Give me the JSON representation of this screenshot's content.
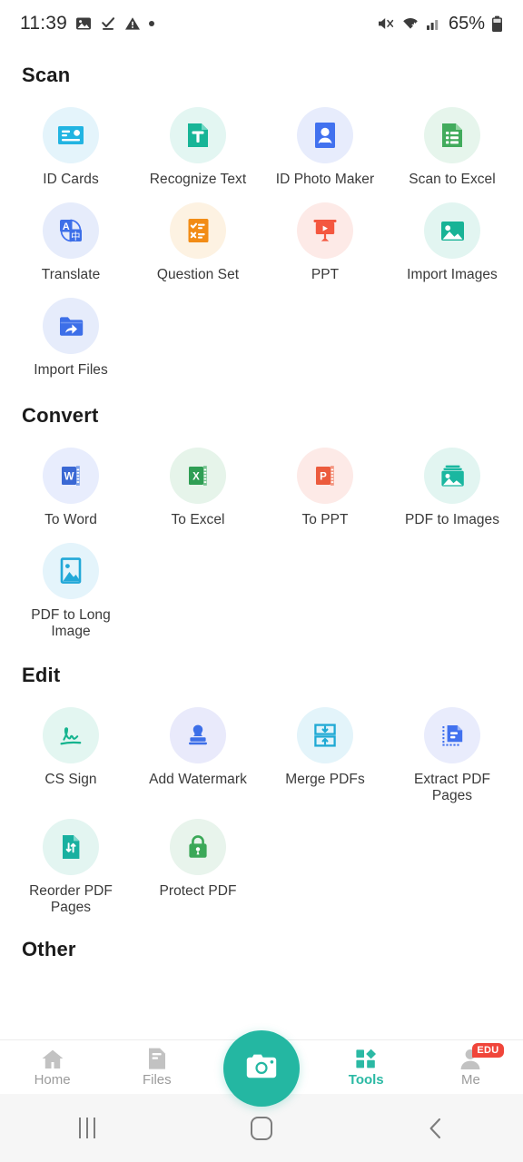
{
  "status_bar": {
    "time": "11:39",
    "left_icons": [
      "image-icon",
      "download-complete-icon",
      "warning-icon",
      "dot-icon"
    ],
    "right_icons": [
      "mute-icon",
      "wifi-icon",
      "signal-icon"
    ],
    "battery_percent": "65%"
  },
  "sections": [
    {
      "id": "scan",
      "title": "Scan",
      "items": [
        {
          "label": "ID Cards",
          "icon": "id-card-icon",
          "bubble": "#e4f4fb",
          "color": "#21b4e2"
        },
        {
          "label": "Recognize Text",
          "icon": "recognize-text-icon",
          "bubble": "#e3f6f2",
          "color": "#17b597"
        },
        {
          "label": "ID Photo Maker",
          "icon": "id-photo-icon",
          "bubble": "#e7ecfc",
          "color": "#4171ef"
        },
        {
          "label": "Scan to Excel",
          "icon": "scan-excel-icon",
          "bubble": "#e6f5ec",
          "color": "#41ab5c"
        },
        {
          "label": "Translate",
          "icon": "translate-icon",
          "bubble": "#e6ecfb",
          "color": "#3d6fe8"
        },
        {
          "label": "Question Set",
          "icon": "question-set-icon",
          "bubble": "#fdf2e2",
          "color": "#f28c16"
        },
        {
          "label": "PPT",
          "icon": "ppt-icon",
          "bubble": "#fdeae7",
          "color": "#f4573f"
        },
        {
          "label": "Import Images",
          "icon": "import-images-icon",
          "bubble": "#e2f5f1",
          "color": "#18b396"
        },
        {
          "label": "Import Files",
          "icon": "import-files-icon",
          "bubble": "#e6ecfb",
          "color": "#3d6fe8"
        }
      ]
    },
    {
      "id": "convert",
      "title": "Convert",
      "items": [
        {
          "label": "To Word",
          "icon": "word-icon",
          "bubble": "#e8edfd",
          "color": "#3a68d4"
        },
        {
          "label": "To Excel",
          "icon": "excel-icon",
          "bubble": "#e6f4ea",
          "color": "#2f9e54"
        },
        {
          "label": "To PPT",
          "icon": "powerpoint-icon",
          "bubble": "#fdeae7",
          "color": "#ec5b3d"
        },
        {
          "label": "PDF to Images",
          "icon": "pdf-images-icon",
          "bubble": "#e2f5f1",
          "color": "#1ab7a0"
        },
        {
          "label": "PDF to Long Image",
          "icon": "long-image-icon",
          "bubble": "#e4f4fb",
          "color": "#22a8d8"
        }
      ]
    },
    {
      "id": "edit",
      "title": "Edit",
      "items": [
        {
          "label": "CS Sign",
          "icon": "signature-icon",
          "bubble": "#e3f6f1",
          "color": "#16b48f"
        },
        {
          "label": "Add Watermark",
          "icon": "stamp-icon",
          "bubble": "#e9eafb",
          "color": "#3d6fe8"
        },
        {
          "label": "Merge PDFs",
          "icon": "merge-pdf-icon",
          "bubble": "#e3f4fa",
          "color": "#1fa9d4"
        },
        {
          "label": "Extract PDF Pages",
          "icon": "extract-pages-icon",
          "bubble": "#e9ecfc",
          "color": "#4171ef"
        },
        {
          "label": "Reorder PDF Pages",
          "icon": "reorder-pages-icon",
          "bubble": "#e3f5f1",
          "color": "#19b0a0"
        },
        {
          "label": "Protect PDF",
          "icon": "lock-icon",
          "bubble": "#e8f4ec",
          "color": "#3ba858"
        }
      ]
    },
    {
      "id": "other",
      "title": "Other",
      "items": []
    }
  ],
  "tab_bar": {
    "camera_button": "camera-icon",
    "tabs": [
      {
        "label": "Home",
        "icon": "home-icon",
        "active": false
      },
      {
        "label": "Files",
        "icon": "files-icon",
        "active": false
      },
      {
        "label": "Tools",
        "icon": "tools-icon",
        "active": true
      },
      {
        "label": "Me",
        "icon": "profile-icon",
        "active": false,
        "badge": "EDU"
      }
    ],
    "active_color": "#2bb9a4",
    "inactive_color": "#9b9b9b",
    "badge_color": "#f0453a",
    "fab_color": "#24b7a2"
  },
  "android_nav": {
    "recent_apps": "recent-apps-icon",
    "home": "home-square-icon",
    "back": "back-chevron-icon"
  }
}
